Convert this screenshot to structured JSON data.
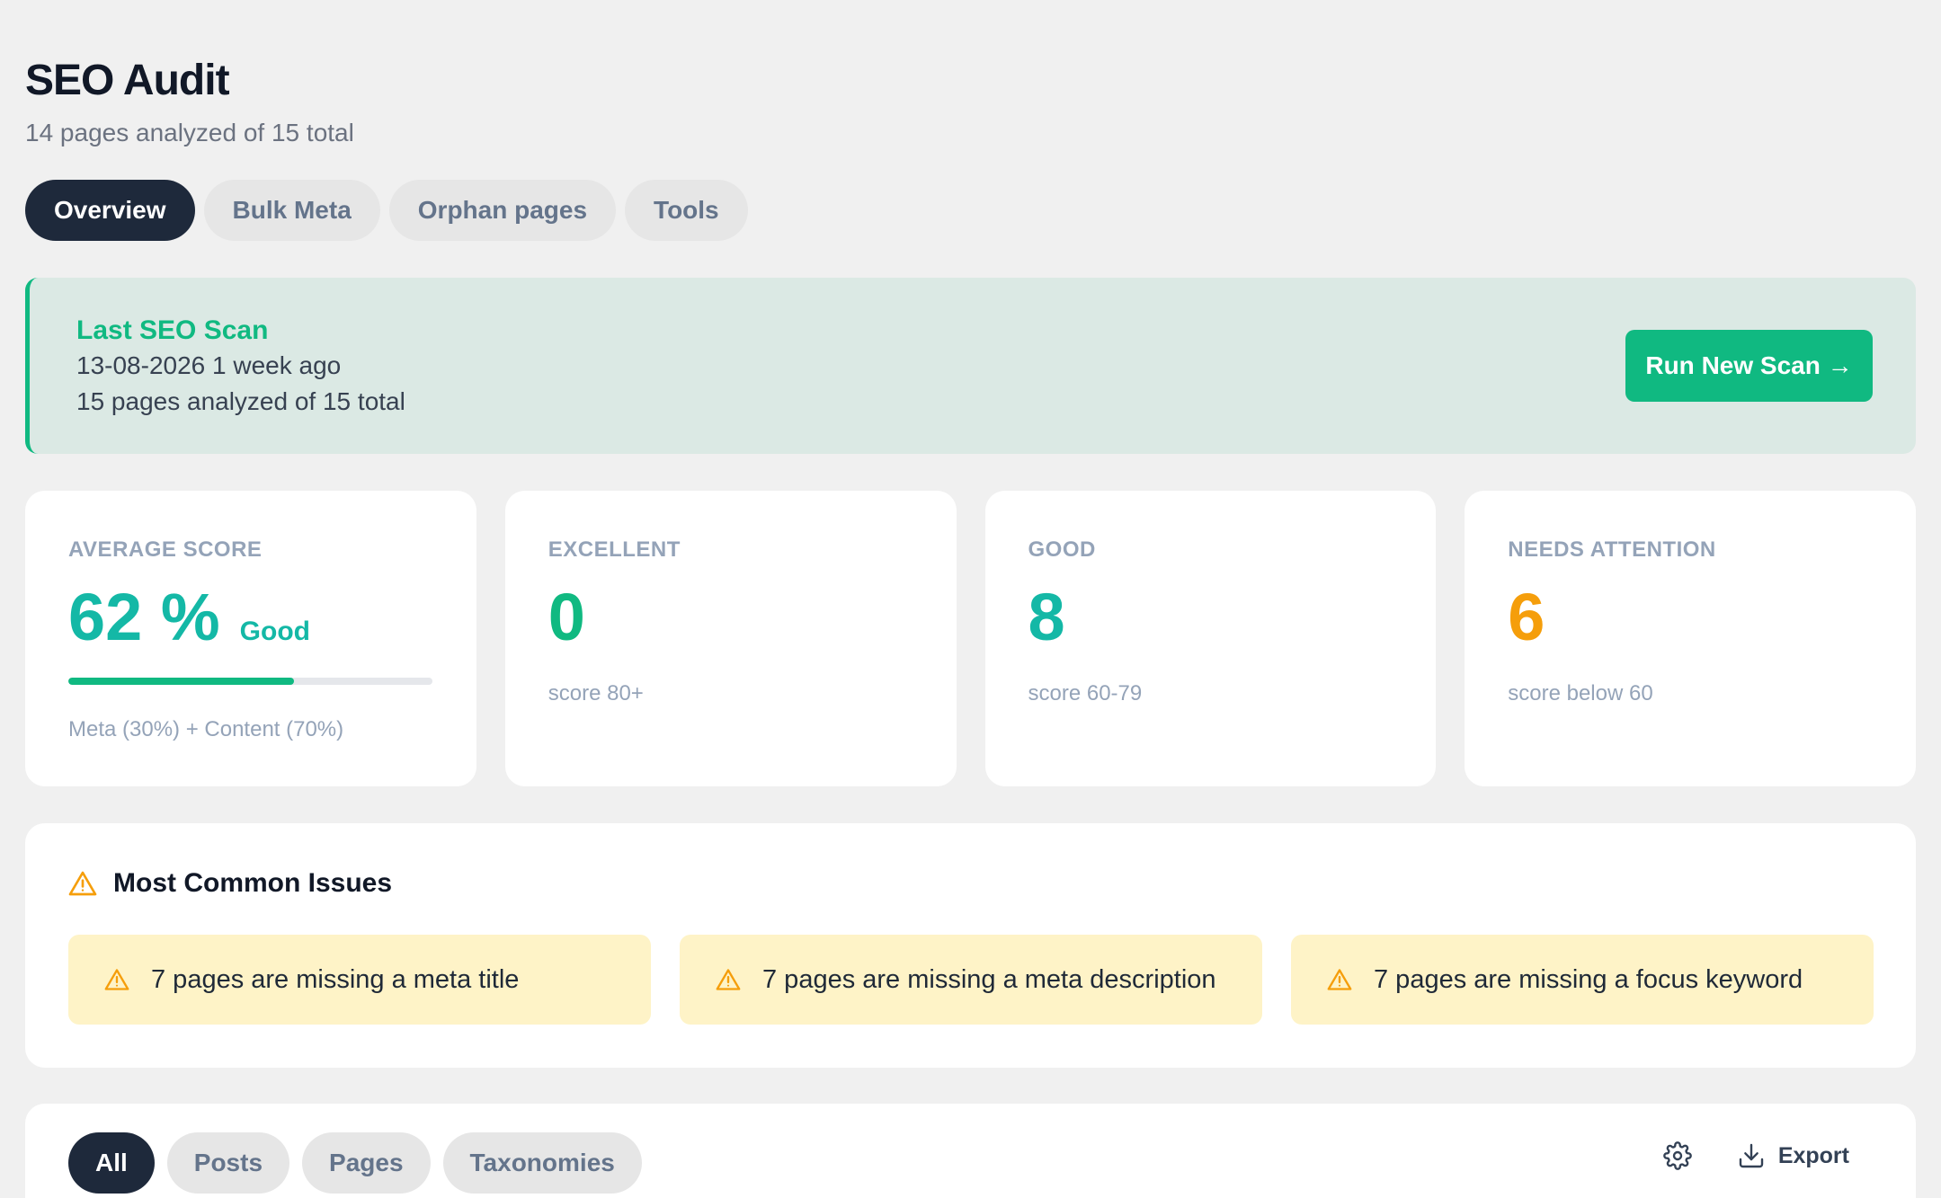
{
  "header": {
    "title": "SEO Audit",
    "subtitle": "14 pages analyzed of 15 total"
  },
  "tabs": [
    {
      "label": "Overview",
      "active": true
    },
    {
      "label": "Bulk Meta",
      "active": false
    },
    {
      "label": "Orphan pages",
      "active": false
    },
    {
      "label": "Tools",
      "active": false
    }
  ],
  "scan": {
    "title": "Last SEO Scan",
    "date": "13-08-2026 1 week ago",
    "pages": "15 pages analyzed of 15 total",
    "button_label": "Run New Scan →"
  },
  "stats": {
    "average": {
      "label": "AVERAGE SCORE",
      "value": "62 %",
      "rating": "Good",
      "progress_percent": 62,
      "note": "Meta (30%) + Content (70%)"
    },
    "excellent": {
      "label": "EXCELLENT",
      "value": "0",
      "note": "score 80+",
      "color": "#10b981"
    },
    "good": {
      "label": "GOOD",
      "value": "8",
      "note": "score 60-79",
      "color": "#14b8a6"
    },
    "attention": {
      "label": "NEEDS ATTENTION",
      "value": "6",
      "note": "score below 60",
      "color": "#f59e0b"
    }
  },
  "issues": {
    "title": "Most Common Issues",
    "icon": "warning-icon",
    "items": [
      "7 pages are missing a meta title",
      "7 pages are missing a meta description",
      "7 pages are missing a focus keyword"
    ]
  },
  "filters": [
    {
      "label": "All",
      "active": true
    },
    {
      "label": "Posts",
      "active": false
    },
    {
      "label": "Pages",
      "active": false
    },
    {
      "label": "Taxonomies",
      "active": false
    }
  ],
  "toolbar": {
    "settings_icon": "gear-icon",
    "export_icon": "download-icon",
    "export_label": "Export"
  },
  "colors": {
    "accent": "#10b981",
    "dark": "#1e293b",
    "warning": "#f59e0b",
    "warning_bg": "#fef3c7"
  }
}
